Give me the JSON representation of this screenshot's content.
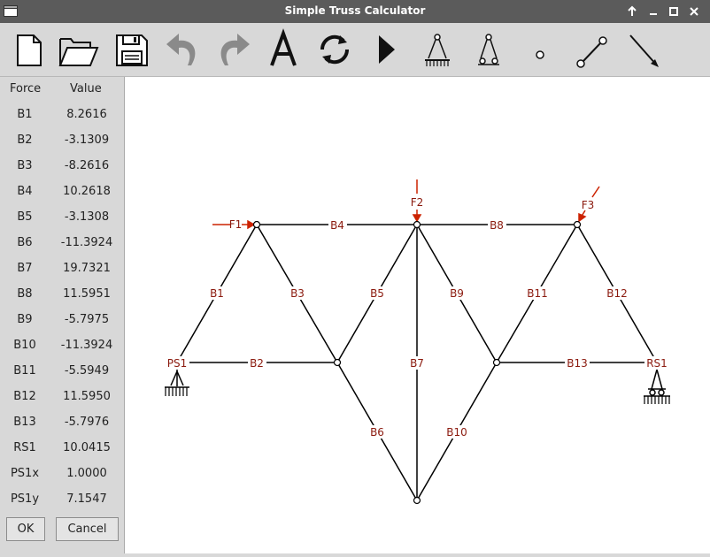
{
  "window": {
    "title": "Simple Truss Calculator"
  },
  "toolbar": {
    "buttons": [
      "new-file",
      "open-folder",
      "save",
      "undo",
      "redo",
      "labels-A",
      "refresh",
      "run",
      "pinned-support",
      "roller-support",
      "node",
      "member",
      "force"
    ]
  },
  "table": {
    "header_force": "Force",
    "header_value": "Value",
    "rows": [
      {
        "name": "B1",
        "value": "8.2616"
      },
      {
        "name": "B2",
        "value": "-3.1309"
      },
      {
        "name": "B3",
        "value": "-8.2616"
      },
      {
        "name": "B4",
        "value": "10.2618"
      },
      {
        "name": "B5",
        "value": "-3.1308"
      },
      {
        "name": "B6",
        "value": "-11.3924"
      },
      {
        "name": "B7",
        "value": "19.7321"
      },
      {
        "name": "B8",
        "value": "11.5951"
      },
      {
        "name": "B9",
        "value": "-5.7975"
      },
      {
        "name": "B10",
        "value": "-11.3924"
      },
      {
        "name": "B11",
        "value": "-5.5949"
      },
      {
        "name": "B12",
        "value": "11.5950"
      },
      {
        "name": "B13",
        "value": "-5.7976"
      },
      {
        "name": "RS1",
        "value": "10.0415"
      },
      {
        "name": "PS1x",
        "value": "1.0000"
      },
      {
        "name": "PS1y",
        "value": "7.1547"
      }
    ]
  },
  "buttons": {
    "ok": "OK",
    "cancel": "Cancel"
  },
  "colors": {
    "label": "#8b1a0e",
    "force": "#cc2200",
    "titlebar": "#5b5b5b"
  },
  "truss": {
    "members": [
      "B1",
      "B2",
      "B3",
      "B4",
      "B5",
      "B6",
      "B7",
      "B8",
      "B9",
      "B10",
      "B11",
      "B12",
      "B13"
    ],
    "supports": [
      "PS1",
      "RS1"
    ],
    "forces": [
      "F1",
      "F2",
      "F3"
    ]
  }
}
